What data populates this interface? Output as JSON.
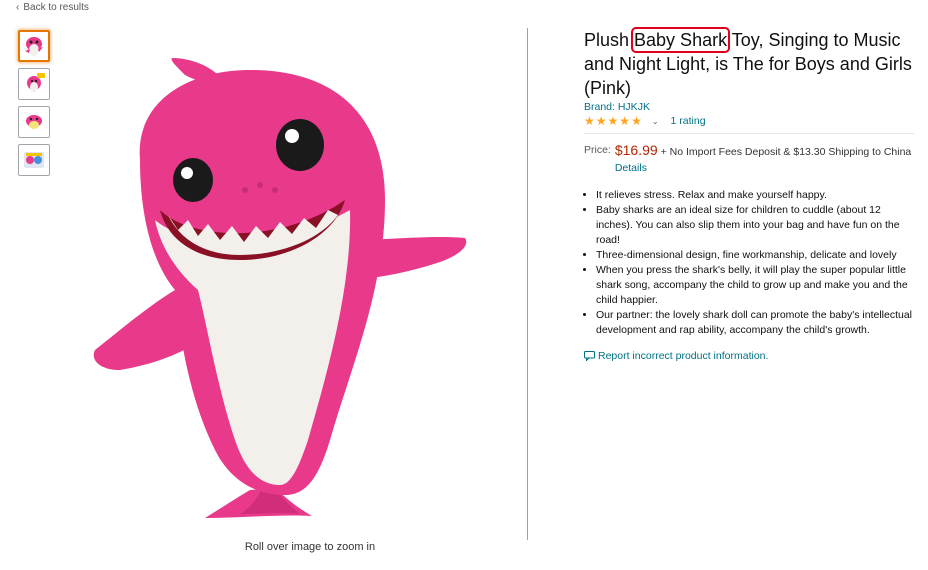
{
  "nav": {
    "back_label": "Back to results"
  },
  "gallery": {
    "thumbnails": [
      "shark-front",
      "shark-logo",
      "shark-side",
      "shark-box"
    ],
    "zoom_hint": "Roll over image to zoom in",
    "colors": {
      "pink": "#e8398b",
      "belly": "#f3f0ec",
      "mouth": "#8a1026"
    }
  },
  "product": {
    "title_prefix": "Plush ",
    "title_highlight": "Baby Shark",
    "title_suffix": " Toy, Singing to Music and Night Light, is The for Boys and Girls (Pink)",
    "brand": "Brand: HJKJK",
    "rating_count": "1 rating",
    "stars": 5,
    "price_label": "Price:",
    "price": "$16.99",
    "price_note": " + No Import Fees Deposit & $13.30 Shipping to China ",
    "details_link": "Details",
    "bullets": [
      "It relieves stress. Relax and make yourself happy.",
      "Baby sharks are an ideal size for children to cuddle (about 12 inches). You can also slip them into your bag and have fun on the road!",
      "Three-dimensional design, fine workmanship, delicate and lovely",
      "When you press the shark's belly, it will play the super popular little shark song, accompany the child to grow up and make you and the child happier.",
      "Our partner: the lovely shark doll can promote the baby's intellectual development and rap ability, accompany the child's growth."
    ],
    "report_link": "Report incorrect product information."
  },
  "colors": {
    "link": "#007185",
    "price": "#b12704",
    "star": "#ffa41c",
    "highlight_box": "#e0001b"
  }
}
